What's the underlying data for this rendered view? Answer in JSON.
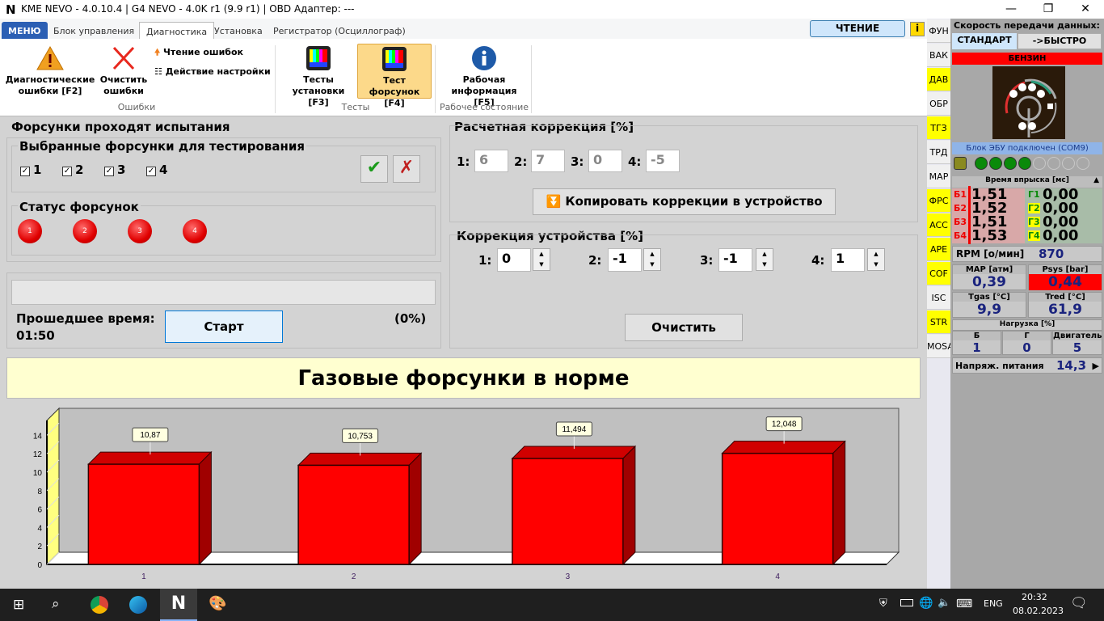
{
  "window": {
    "logo": "N",
    "title": "KME NEVO - 4.0.10.4  |  G4 NEVO - 4.0K r1 (9.9 r1)  |  OBD Адаптер: ---",
    "minimize": "—",
    "maximize": "❐",
    "close": "✕"
  },
  "tabs": [
    "МЕНЮ",
    "Блок управления",
    "Диагностика",
    "Установка",
    "Регистратор (Осциллограф)"
  ],
  "read_button": "ЧТЕНИЕ",
  "ribbon": {
    "diag_errors": "Диагностические ошибки [F2]",
    "clear_errors": "Очистить ошибки",
    "read_errors": "Чтение ошибок",
    "settings_action": "Действие настройки",
    "group_errors": "Ошибки",
    "install_tests": "Тесты установки [F3]",
    "injector_test": "Тест форсунок [F4]",
    "group_tests": "Тесты",
    "work_info": "Рабочая информация [F5]",
    "group_state": "Рабочее состояние"
  },
  "injectors": {
    "title": "Форсунки проходят испытания",
    "selected_title": "Выбранные форсунки для тестирования",
    "checks": [
      "1",
      "2",
      "3",
      "4"
    ],
    "status_title": "Статус форсунок",
    "status": [
      "1",
      "2",
      "3",
      "4"
    ]
  },
  "progress": {
    "percent": 0,
    "percent_label": "(0%)",
    "elapsed_label": "Прошедшее время:",
    "elapsed": "01:50",
    "start": "Старт"
  },
  "calc": {
    "title": "Расчетная коррекция [%]",
    "labels": [
      "1:",
      "2:",
      "3:",
      "4:"
    ],
    "values": [
      "6",
      "7",
      "0",
      "-5"
    ],
    "copy": "Копировать коррекции в устройство"
  },
  "device": {
    "title": "Коррекция устройства [%]",
    "labels": [
      "1:",
      "2:",
      "3:",
      "4:"
    ],
    "values": [
      "0",
      "-1",
      "-1",
      "1"
    ],
    "clear": "Очистить"
  },
  "result": "Газовые форсунки в норме",
  "chart_data": {
    "type": "bar",
    "categories": [
      "1",
      "2",
      "3",
      "4"
    ],
    "values": [
      10.87,
      10.753,
      11.494,
      12.048
    ],
    "labels": [
      "10,87",
      "10,753",
      "11,494",
      "12,048"
    ],
    "yticks": [
      "0",
      "2",
      "4",
      "6",
      "8",
      "10",
      "12",
      "14"
    ],
    "ylim": [
      0,
      15
    ],
    "color": "#ff0000"
  },
  "side_tabs": [
    {
      "l": "ФУН",
      "y": false
    },
    {
      "l": "ВАК",
      "y": false
    },
    {
      "l": "ДАВ",
      "y": true
    },
    {
      "l": "ОБР",
      "y": false
    },
    {
      "l": "ТГЗ",
      "y": true
    },
    {
      "l": "ТРД",
      "y": false
    },
    {
      "l": "MAP",
      "y": false
    },
    {
      "l": "ФРС",
      "y": true
    },
    {
      "l": "ACC",
      "y": true
    },
    {
      "l": "APE",
      "y": true
    },
    {
      "l": "COF",
      "y": true
    },
    {
      "l": "ISC",
      "y": false
    },
    {
      "l": "STR",
      "y": true
    },
    {
      "l": "MOSA",
      "y": false
    }
  ],
  "right": {
    "speed_title": "Скорость передачи данных:",
    "standard": "СТАНДАРТ",
    "fast": "->БЫСТРО",
    "fuel": "БЕНЗИН",
    "ecu": "Блок ЭБУ подключен (COM9)",
    "inj_title": "Время впрыска [мс]",
    "b": [
      [
        "Б1",
        "1,51"
      ],
      [
        "Б2",
        "1,52"
      ],
      [
        "Б3",
        "1,51"
      ],
      [
        "Б4",
        "1,53"
      ]
    ],
    "g": [
      [
        "Г1",
        "0,00"
      ],
      [
        "Г2",
        "0,00"
      ],
      [
        "Г3",
        "0,00"
      ],
      [
        "Г4",
        "0,00"
      ]
    ],
    "rpm_label": "RPM [о/мин]",
    "rpm": "870",
    "map_label": "MAP [атм]",
    "map": "0,39",
    "psys_label": "Psys [bar]",
    "psys": "0,44",
    "tgas_label": "Tgas [°C]",
    "tgas": "9,9",
    "tred_label": "Tred [°C]",
    "tred": "61,9",
    "load_title": "Нагрузка [%]",
    "load_b_label": "Б",
    "load_b": "1",
    "load_g_label": "Г",
    "load_g": "0",
    "load_e_label": "Двигатель",
    "load_e": "5",
    "volt_label": "Напряж. питания",
    "volt": "14,3"
  },
  "taskbar": {
    "lang": "ENG",
    "time": "20:32",
    "date": "08.02.2023"
  },
  "colors": {
    "accent": "#2b5fb4",
    "alert": "#ff0000",
    "result_bg": "#ffffd0"
  }
}
